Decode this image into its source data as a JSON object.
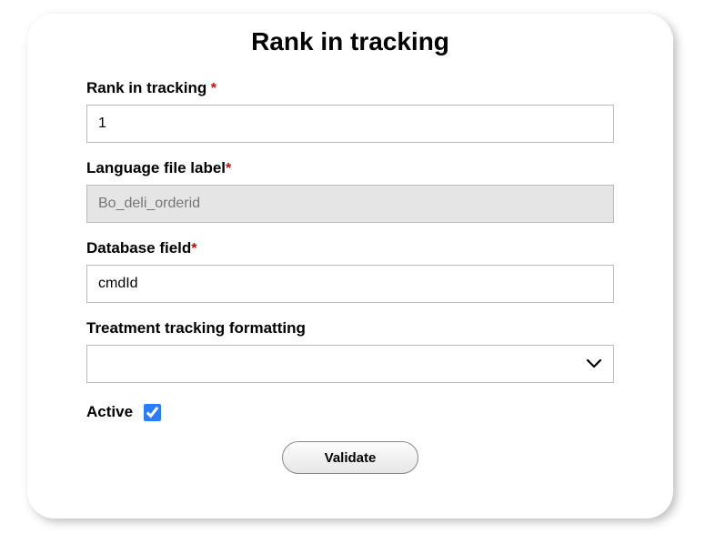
{
  "title": "Rank in tracking",
  "fields": {
    "rank": {
      "label": "Rank in tracking",
      "required_mark": " *",
      "value": "1"
    },
    "language_label": {
      "label": "Language file label",
      "required_mark": "*",
      "value": "Bo_deli_orderid"
    },
    "db_field": {
      "label": "Database field",
      "required_mark": "*",
      "value": "cmdId"
    },
    "formatting": {
      "label": "Treatment tracking formatting",
      "selected": ""
    },
    "active": {
      "label": "Active"
    }
  },
  "buttons": {
    "validate": "Validate"
  }
}
